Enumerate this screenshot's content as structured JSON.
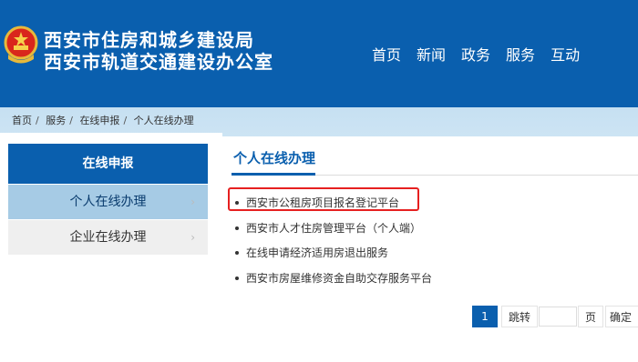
{
  "header": {
    "title_line1": "西安市住房和城乡建设局",
    "title_line2": "西安市轨道交通建设办公室",
    "nav": [
      "首页",
      "新闻",
      "政务",
      "服务",
      "互动"
    ],
    "emblem_icon": "national-emblem-icon",
    "bg_color": "#0a5fae"
  },
  "breadcrumb": [
    "首页",
    "服务",
    "在线申报",
    "个人在线办理"
  ],
  "sidebar": {
    "title": "在线申报",
    "items": [
      {
        "label": "个人在线办理",
        "active": true
      },
      {
        "label": "企业在线办理",
        "active": false
      }
    ]
  },
  "main": {
    "title": "个人在线办理",
    "list": [
      "西安市公租房项目报名登记平台",
      "西安市人才住房管理平台（个人端）",
      "在线申请经济适用房退出服务",
      "西安市房屋维修资金自助交存服务平台"
    ]
  },
  "pagination": {
    "current_page": "1",
    "jump_label": "跳转",
    "page_label": "页",
    "confirm_label": "确定",
    "input_value": ""
  }
}
